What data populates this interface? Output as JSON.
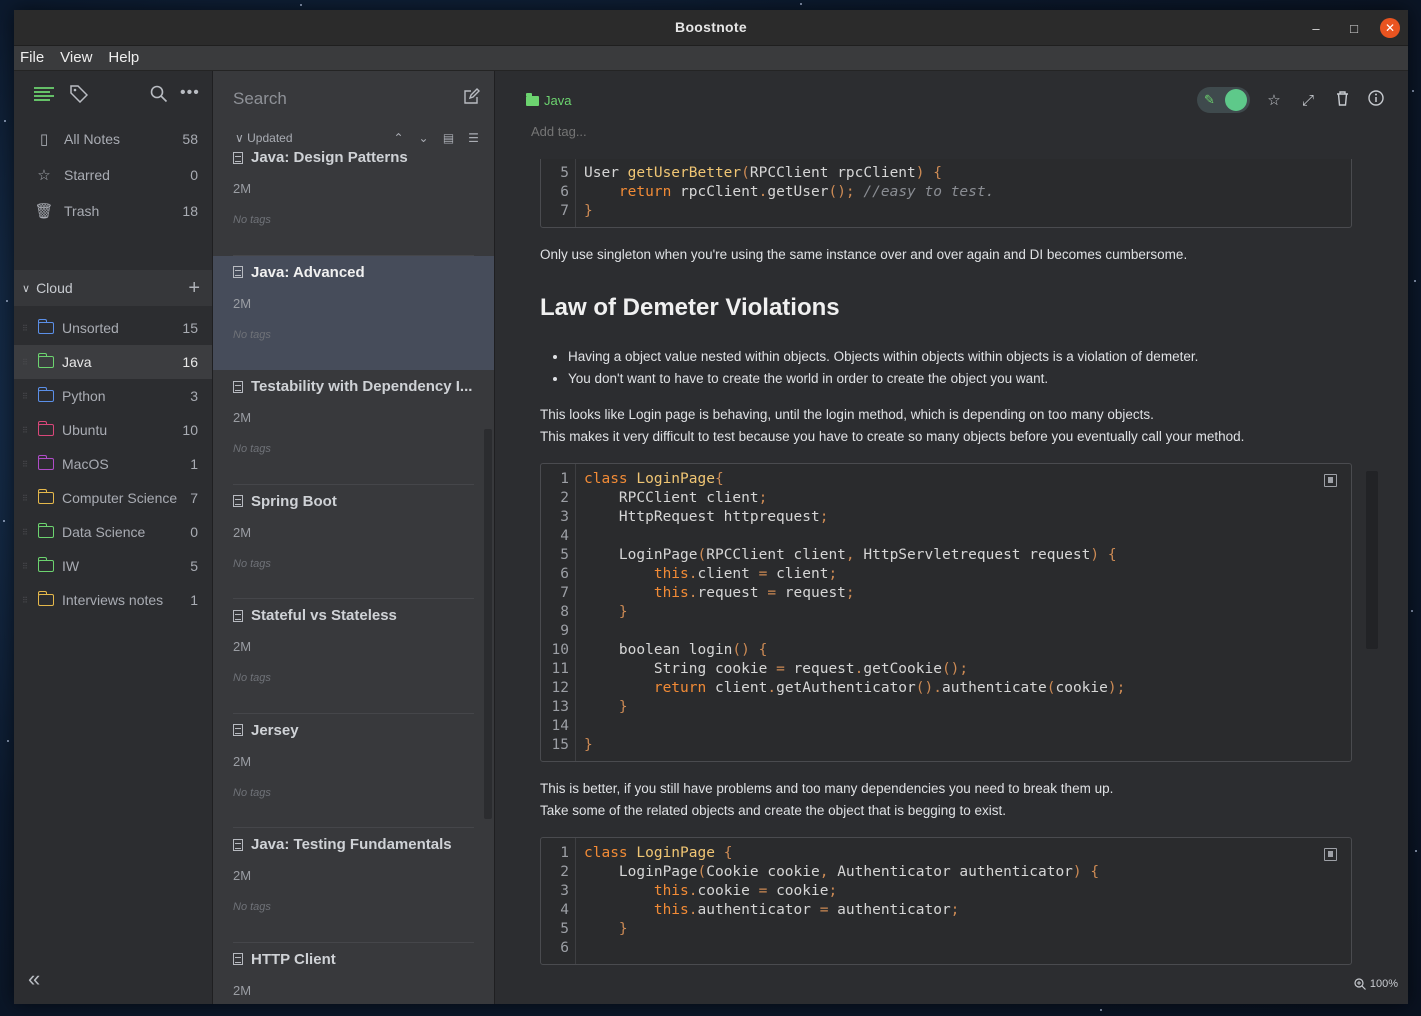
{
  "window": {
    "title": "Boostnote",
    "controls": [
      "–",
      "□",
      "✕"
    ]
  },
  "menu": [
    "File",
    "View",
    "Help"
  ],
  "sidebar": {
    "nav": [
      {
        "icon": "notes-icon",
        "glyph": "▯",
        "label": "All Notes",
        "count": "58"
      },
      {
        "icon": "star-icon",
        "glyph": "☆",
        "label": "Starred",
        "count": "0"
      },
      {
        "icon": "trash-icon",
        "glyph": "🗑",
        "label": "Trash",
        "count": "18"
      }
    ],
    "storage": {
      "label": "Cloud"
    },
    "folders": [
      {
        "label": "Unsorted",
        "count": "15",
        "color": "#5b8fe8"
      },
      {
        "label": "Java",
        "count": "16",
        "color": "#6cd36f",
        "active": true
      },
      {
        "label": "Python",
        "count": "3",
        "color": "#5b8fe8"
      },
      {
        "label": "Ubuntu",
        "count": "10",
        "color": "#d9477a"
      },
      {
        "label": "MacOS",
        "count": "1",
        "color": "#b04cc8"
      },
      {
        "label": "Computer Science",
        "count": "7",
        "color": "#e5b84b"
      },
      {
        "label": "Data Science",
        "count": "0",
        "color": "#6cd36f"
      },
      {
        "label": "IW",
        "count": "5",
        "color": "#6cd36f"
      },
      {
        "label": "Interviews notes",
        "count": "1",
        "color": "#e5b84b"
      }
    ]
  },
  "notelist": {
    "search_placeholder": "Search",
    "sort_label": "Updated",
    "notes": [
      {
        "title": "Java: Design Patterns",
        "date": "2M",
        "tags": "No tags"
      },
      {
        "title": "Java: Advanced",
        "date": "2M",
        "tags": "No tags",
        "active": true
      },
      {
        "title": "Testability with Dependency I...",
        "date": "2M",
        "tags": "No tags"
      },
      {
        "title": "Spring Boot",
        "date": "2M",
        "tags": "No tags"
      },
      {
        "title": "Stateful vs Stateless",
        "date": "2M",
        "tags": "No tags"
      },
      {
        "title": "Jersey",
        "date": "2M",
        "tags": "No tags"
      },
      {
        "title": "Java: Testing Fundamentals",
        "date": "2M",
        "tags": "No tags"
      },
      {
        "title": "HTTP Client",
        "date": "2M",
        "tags": ""
      }
    ]
  },
  "editor": {
    "folder": "Java",
    "add_tag_placeholder": "Add tag...",
    "zoom": "100%",
    "para1": "Only use singleton when you're using the same instance over and over again and DI becomes cumbersome.",
    "heading": "Law of Demeter Violations",
    "bullets": [
      "Having a object value nested within objects. Objects within objects within objects is a violation of demeter.",
      "You don't want to have to create the world in order to create the object you want."
    ],
    "para2a": "This looks like Login page is behaving, until the login method, which is depending on too many objects.",
    "para2b": "This makes it very difficult to test because you have to create so many objects before you eventually call your method.",
    "para3a": "This is better, if you still have problems and too many dependencies you need to break them up.",
    "para3b": "Take some of the related objects and create the object that is begging to exist.",
    "code1_lines": [
      "5",
      "6",
      "7"
    ],
    "code2_lines": [
      "1",
      "2",
      "3",
      "4",
      "5",
      "6",
      "7",
      "8",
      "9",
      "10",
      "11",
      "12",
      "13",
      "14",
      "15"
    ],
    "code3_lines": [
      "1",
      "2",
      "3",
      "4",
      "5",
      "6"
    ]
  }
}
